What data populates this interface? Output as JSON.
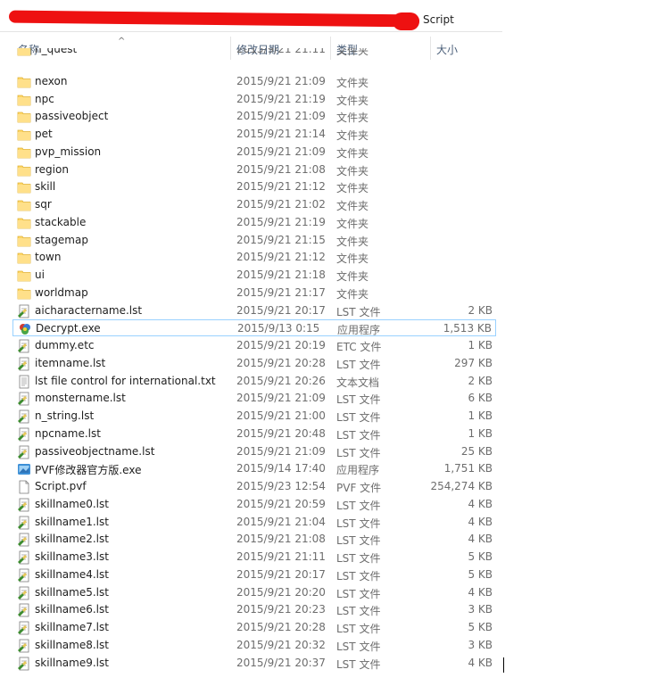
{
  "address": {
    "path_tail": "Script"
  },
  "columns": {
    "name": "名称",
    "date": "修改日期",
    "type": "类型",
    "size": "大小"
  },
  "files": [
    {
      "name": "n_quest",
      "date": "2015/9/21 21:11",
      "type": "文件夹",
      "size": "",
      "icon": "folder-icon",
      "partial": true
    },
    {
      "name": "nexon",
      "date": "2015/9/21 21:09",
      "type": "文件夹",
      "size": "",
      "icon": "folder-icon"
    },
    {
      "name": "npc",
      "date": "2015/9/21 21:19",
      "type": "文件夹",
      "size": "",
      "icon": "folder-icon"
    },
    {
      "name": "passiveobject",
      "date": "2015/9/21 21:09",
      "type": "文件夹",
      "size": "",
      "icon": "folder-icon"
    },
    {
      "name": "pet",
      "date": "2015/9/21 21:14",
      "type": "文件夹",
      "size": "",
      "icon": "folder-icon"
    },
    {
      "name": "pvp_mission",
      "date": "2015/9/21 21:09",
      "type": "文件夹",
      "size": "",
      "icon": "folder-icon"
    },
    {
      "name": "region",
      "date": "2015/9/21 21:08",
      "type": "文件夹",
      "size": "",
      "icon": "folder-icon"
    },
    {
      "name": "skill",
      "date": "2015/9/21 21:12",
      "type": "文件夹",
      "size": "",
      "icon": "folder-icon"
    },
    {
      "name": "sqr",
      "date": "2015/9/21 21:02",
      "type": "文件夹",
      "size": "",
      "icon": "folder-icon"
    },
    {
      "name": "stackable",
      "date": "2015/9/21 21:19",
      "type": "文件夹",
      "size": "",
      "icon": "folder-icon"
    },
    {
      "name": "stagemap",
      "date": "2015/9/21 21:15",
      "type": "文件夹",
      "size": "",
      "icon": "folder-icon"
    },
    {
      "name": "town",
      "date": "2015/9/21 21:12",
      "type": "文件夹",
      "size": "",
      "icon": "folder-icon"
    },
    {
      "name": "ui",
      "date": "2015/9/21 21:18",
      "type": "文件夹",
      "size": "",
      "icon": "folder-icon"
    },
    {
      "name": "worldmap",
      "date": "2015/9/21 21:17",
      "type": "文件夹",
      "size": "",
      "icon": "folder-icon"
    },
    {
      "name": "aicharactername.lst",
      "date": "2015/9/21 20:17",
      "type": "LST 文件",
      "size": "2 KB",
      "icon": "lst-file-icon"
    },
    {
      "name": "Decrypt.exe",
      "date": "2015/9/13 0:15",
      "type": "应用程序",
      "size": "1,513 KB",
      "icon": "exe-app-icon",
      "selected": true
    },
    {
      "name": "dummy.etc",
      "date": "2015/9/21 20:19",
      "type": "ETC 文件",
      "size": "1 KB",
      "icon": "lst-file-icon"
    },
    {
      "name": "itemname.lst",
      "date": "2015/9/21 20:28",
      "type": "LST 文件",
      "size": "297 KB",
      "icon": "lst-file-icon"
    },
    {
      "name": "lst file control for international.txt",
      "date": "2015/9/21 20:26",
      "type": "文本文档",
      "size": "2 KB",
      "icon": "text-file-icon"
    },
    {
      "name": "monstername.lst",
      "date": "2015/9/21 21:09",
      "type": "LST 文件",
      "size": "6 KB",
      "icon": "lst-file-icon"
    },
    {
      "name": "n_string.lst",
      "date": "2015/9/21 21:00",
      "type": "LST 文件",
      "size": "1 KB",
      "icon": "lst-file-icon"
    },
    {
      "name": "npcname.lst",
      "date": "2015/9/21 20:48",
      "type": "LST 文件",
      "size": "1 KB",
      "icon": "lst-file-icon"
    },
    {
      "name": "passiveobjectname.lst",
      "date": "2015/9/21 21:09",
      "type": "LST 文件",
      "size": "25 KB",
      "icon": "lst-file-icon"
    },
    {
      "name": "PVF修改器官方版.exe",
      "date": "2015/9/14 17:40",
      "type": "应用程序",
      "size": "1,751 KB",
      "icon": "pvf-app-icon"
    },
    {
      "name": "Script.pvf",
      "date": "2015/9/23 12:54",
      "type": "PVF 文件",
      "size": "254,274 KB",
      "icon": "blank-file-icon"
    },
    {
      "name": "skillname0.lst",
      "date": "2015/9/21 20:59",
      "type": "LST 文件",
      "size": "4 KB",
      "icon": "lst-file-icon"
    },
    {
      "name": "skillname1.lst",
      "date": "2015/9/21 21:04",
      "type": "LST 文件",
      "size": "4 KB",
      "icon": "lst-file-icon"
    },
    {
      "name": "skillname2.lst",
      "date": "2015/9/21 21:08",
      "type": "LST 文件",
      "size": "4 KB",
      "icon": "lst-file-icon"
    },
    {
      "name": "skillname3.lst",
      "date": "2015/9/21 21:11",
      "type": "LST 文件",
      "size": "5 KB",
      "icon": "lst-file-icon"
    },
    {
      "name": "skillname4.lst",
      "date": "2015/9/21 20:17",
      "type": "LST 文件",
      "size": "5 KB",
      "icon": "lst-file-icon"
    },
    {
      "name": "skillname5.lst",
      "date": "2015/9/21 20:20",
      "type": "LST 文件",
      "size": "4 KB",
      "icon": "lst-file-icon"
    },
    {
      "name": "skillname6.lst",
      "date": "2015/9/21 20:23",
      "type": "LST 文件",
      "size": "3 KB",
      "icon": "lst-file-icon"
    },
    {
      "name": "skillname7.lst",
      "date": "2015/9/21 20:28",
      "type": "LST 文件",
      "size": "5 KB",
      "icon": "lst-file-icon"
    },
    {
      "name": "skillname8.lst",
      "date": "2015/9/21 20:32",
      "type": "LST 文件",
      "size": "3 KB",
      "icon": "lst-file-icon"
    },
    {
      "name": "skillname9.lst",
      "date": "2015/9/21 20:37",
      "type": "LST 文件",
      "size": "4 KB",
      "icon": "lst-file-icon"
    }
  ],
  "colors": {
    "folder": "#ffd766",
    "selection_border": "#99d1ff",
    "header_text": "#4c607a",
    "redaction": "#ee1111"
  }
}
